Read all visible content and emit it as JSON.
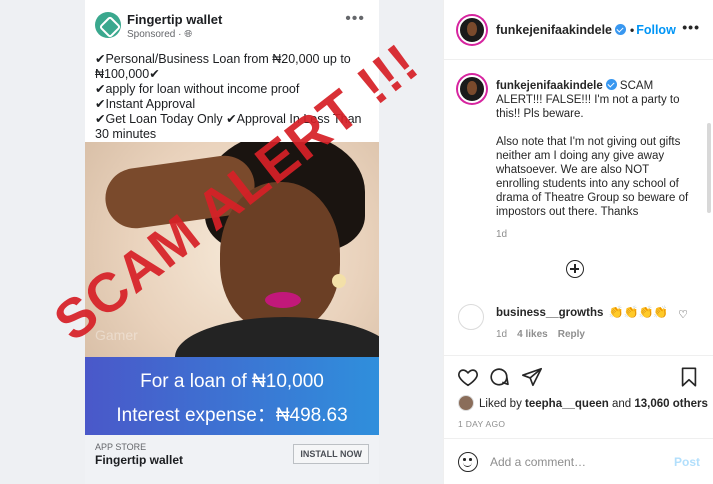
{
  "ad": {
    "brand": "Fingertip wallet",
    "sponsored": "Sponsored · ",
    "sponsored_icon": "globe-icon",
    "more": "•••",
    "lines": [
      "✔Personal/Business Loan from ₦20,000 up to ₦100,000✔",
      "✔apply for loan without income proof",
      "✔Instant Approval",
      "✔Get Loan Today Only ✔Approval In Less Than 30 minutes"
    ],
    "banner_line1": "For a loan of ₦10,000",
    "banner_line2": "Interest expense：₦498.63",
    "store_label": "APP STORE",
    "footer_brand": "Fingertip wallet",
    "install_label": "INSTALL NOW",
    "photo_watermark": "Gamer"
  },
  "stamp": {
    "text": "SCAM ALERT !!!",
    "color": "#d62027"
  },
  "header": {
    "username": "funkejenifaakindele",
    "dot": "•",
    "follow": "Follow",
    "more": "•••"
  },
  "caption": {
    "username": "funkejenifaakindele",
    "text1": " SCAM ALERT!!! FALSE!!! I'm not a party to this!! Pls beware.",
    "text2": "Also note that I'm not giving out gifts neither am I doing any give away whatsoever. We are also NOT enrolling students into any school of drama of Theatre Group so beware of impostors out there. Thanks",
    "time": "1d"
  },
  "comment": {
    "username": "business__growths",
    "emoji": "👏👏👏👏",
    "time": "1d",
    "likes": "4 likes",
    "reply": "Reply",
    "heart": "♡"
  },
  "actions": {
    "liked_prefix": "Liked by ",
    "liked_user": "teepha__queen",
    "liked_mid": " and ",
    "liked_count": "13,060 others",
    "date": "1 DAY AGO"
  },
  "add_comment": {
    "placeholder": "Add a comment…",
    "post": "Post"
  },
  "colors": {
    "accent": "#0095f6",
    "verified": "#3897f0",
    "stamp": "#d62027"
  }
}
